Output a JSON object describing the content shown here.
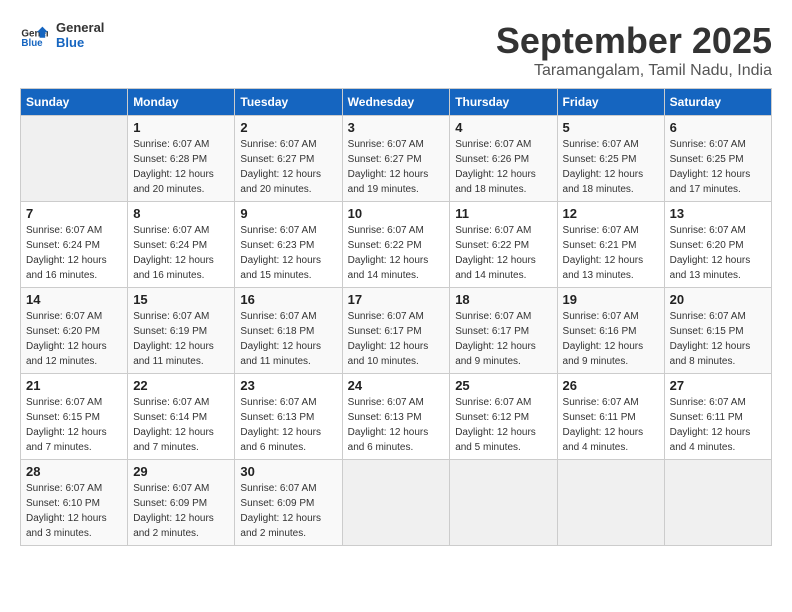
{
  "logo": {
    "line1": "General",
    "line2": "Blue"
  },
  "title": "September 2025",
  "subtitle": "Taramangalam, Tamil Nadu, India",
  "days_header": [
    "Sunday",
    "Monday",
    "Tuesday",
    "Wednesday",
    "Thursday",
    "Friday",
    "Saturday"
  ],
  "weeks": [
    [
      {
        "day": "",
        "info": ""
      },
      {
        "day": "1",
        "info": "Sunrise: 6:07 AM\nSunset: 6:28 PM\nDaylight: 12 hours\nand 20 minutes."
      },
      {
        "day": "2",
        "info": "Sunrise: 6:07 AM\nSunset: 6:27 PM\nDaylight: 12 hours\nand 20 minutes."
      },
      {
        "day": "3",
        "info": "Sunrise: 6:07 AM\nSunset: 6:27 PM\nDaylight: 12 hours\nand 19 minutes."
      },
      {
        "day": "4",
        "info": "Sunrise: 6:07 AM\nSunset: 6:26 PM\nDaylight: 12 hours\nand 18 minutes."
      },
      {
        "day": "5",
        "info": "Sunrise: 6:07 AM\nSunset: 6:25 PM\nDaylight: 12 hours\nand 18 minutes."
      },
      {
        "day": "6",
        "info": "Sunrise: 6:07 AM\nSunset: 6:25 PM\nDaylight: 12 hours\nand 17 minutes."
      }
    ],
    [
      {
        "day": "7",
        "info": "Sunrise: 6:07 AM\nSunset: 6:24 PM\nDaylight: 12 hours\nand 16 minutes."
      },
      {
        "day": "8",
        "info": "Sunrise: 6:07 AM\nSunset: 6:24 PM\nDaylight: 12 hours\nand 16 minutes."
      },
      {
        "day": "9",
        "info": "Sunrise: 6:07 AM\nSunset: 6:23 PM\nDaylight: 12 hours\nand 15 minutes."
      },
      {
        "day": "10",
        "info": "Sunrise: 6:07 AM\nSunset: 6:22 PM\nDaylight: 12 hours\nand 14 minutes."
      },
      {
        "day": "11",
        "info": "Sunrise: 6:07 AM\nSunset: 6:22 PM\nDaylight: 12 hours\nand 14 minutes."
      },
      {
        "day": "12",
        "info": "Sunrise: 6:07 AM\nSunset: 6:21 PM\nDaylight: 12 hours\nand 13 minutes."
      },
      {
        "day": "13",
        "info": "Sunrise: 6:07 AM\nSunset: 6:20 PM\nDaylight: 12 hours\nand 13 minutes."
      }
    ],
    [
      {
        "day": "14",
        "info": "Sunrise: 6:07 AM\nSunset: 6:20 PM\nDaylight: 12 hours\nand 12 minutes."
      },
      {
        "day": "15",
        "info": "Sunrise: 6:07 AM\nSunset: 6:19 PM\nDaylight: 12 hours\nand 11 minutes."
      },
      {
        "day": "16",
        "info": "Sunrise: 6:07 AM\nSunset: 6:18 PM\nDaylight: 12 hours\nand 11 minutes."
      },
      {
        "day": "17",
        "info": "Sunrise: 6:07 AM\nSunset: 6:17 PM\nDaylight: 12 hours\nand 10 minutes."
      },
      {
        "day": "18",
        "info": "Sunrise: 6:07 AM\nSunset: 6:17 PM\nDaylight: 12 hours\nand 9 minutes."
      },
      {
        "day": "19",
        "info": "Sunrise: 6:07 AM\nSunset: 6:16 PM\nDaylight: 12 hours\nand 9 minutes."
      },
      {
        "day": "20",
        "info": "Sunrise: 6:07 AM\nSunset: 6:15 PM\nDaylight: 12 hours\nand 8 minutes."
      }
    ],
    [
      {
        "day": "21",
        "info": "Sunrise: 6:07 AM\nSunset: 6:15 PM\nDaylight: 12 hours\nand 7 minutes."
      },
      {
        "day": "22",
        "info": "Sunrise: 6:07 AM\nSunset: 6:14 PM\nDaylight: 12 hours\nand 7 minutes."
      },
      {
        "day": "23",
        "info": "Sunrise: 6:07 AM\nSunset: 6:13 PM\nDaylight: 12 hours\nand 6 minutes."
      },
      {
        "day": "24",
        "info": "Sunrise: 6:07 AM\nSunset: 6:13 PM\nDaylight: 12 hours\nand 6 minutes."
      },
      {
        "day": "25",
        "info": "Sunrise: 6:07 AM\nSunset: 6:12 PM\nDaylight: 12 hours\nand 5 minutes."
      },
      {
        "day": "26",
        "info": "Sunrise: 6:07 AM\nSunset: 6:11 PM\nDaylight: 12 hours\nand 4 minutes."
      },
      {
        "day": "27",
        "info": "Sunrise: 6:07 AM\nSunset: 6:11 PM\nDaylight: 12 hours\nand 4 minutes."
      }
    ],
    [
      {
        "day": "28",
        "info": "Sunrise: 6:07 AM\nSunset: 6:10 PM\nDaylight: 12 hours\nand 3 minutes."
      },
      {
        "day": "29",
        "info": "Sunrise: 6:07 AM\nSunset: 6:09 PM\nDaylight: 12 hours\nand 2 minutes."
      },
      {
        "day": "30",
        "info": "Sunrise: 6:07 AM\nSunset: 6:09 PM\nDaylight: 12 hours\nand 2 minutes."
      },
      {
        "day": "",
        "info": ""
      },
      {
        "day": "",
        "info": ""
      },
      {
        "day": "",
        "info": ""
      },
      {
        "day": "",
        "info": ""
      }
    ]
  ]
}
